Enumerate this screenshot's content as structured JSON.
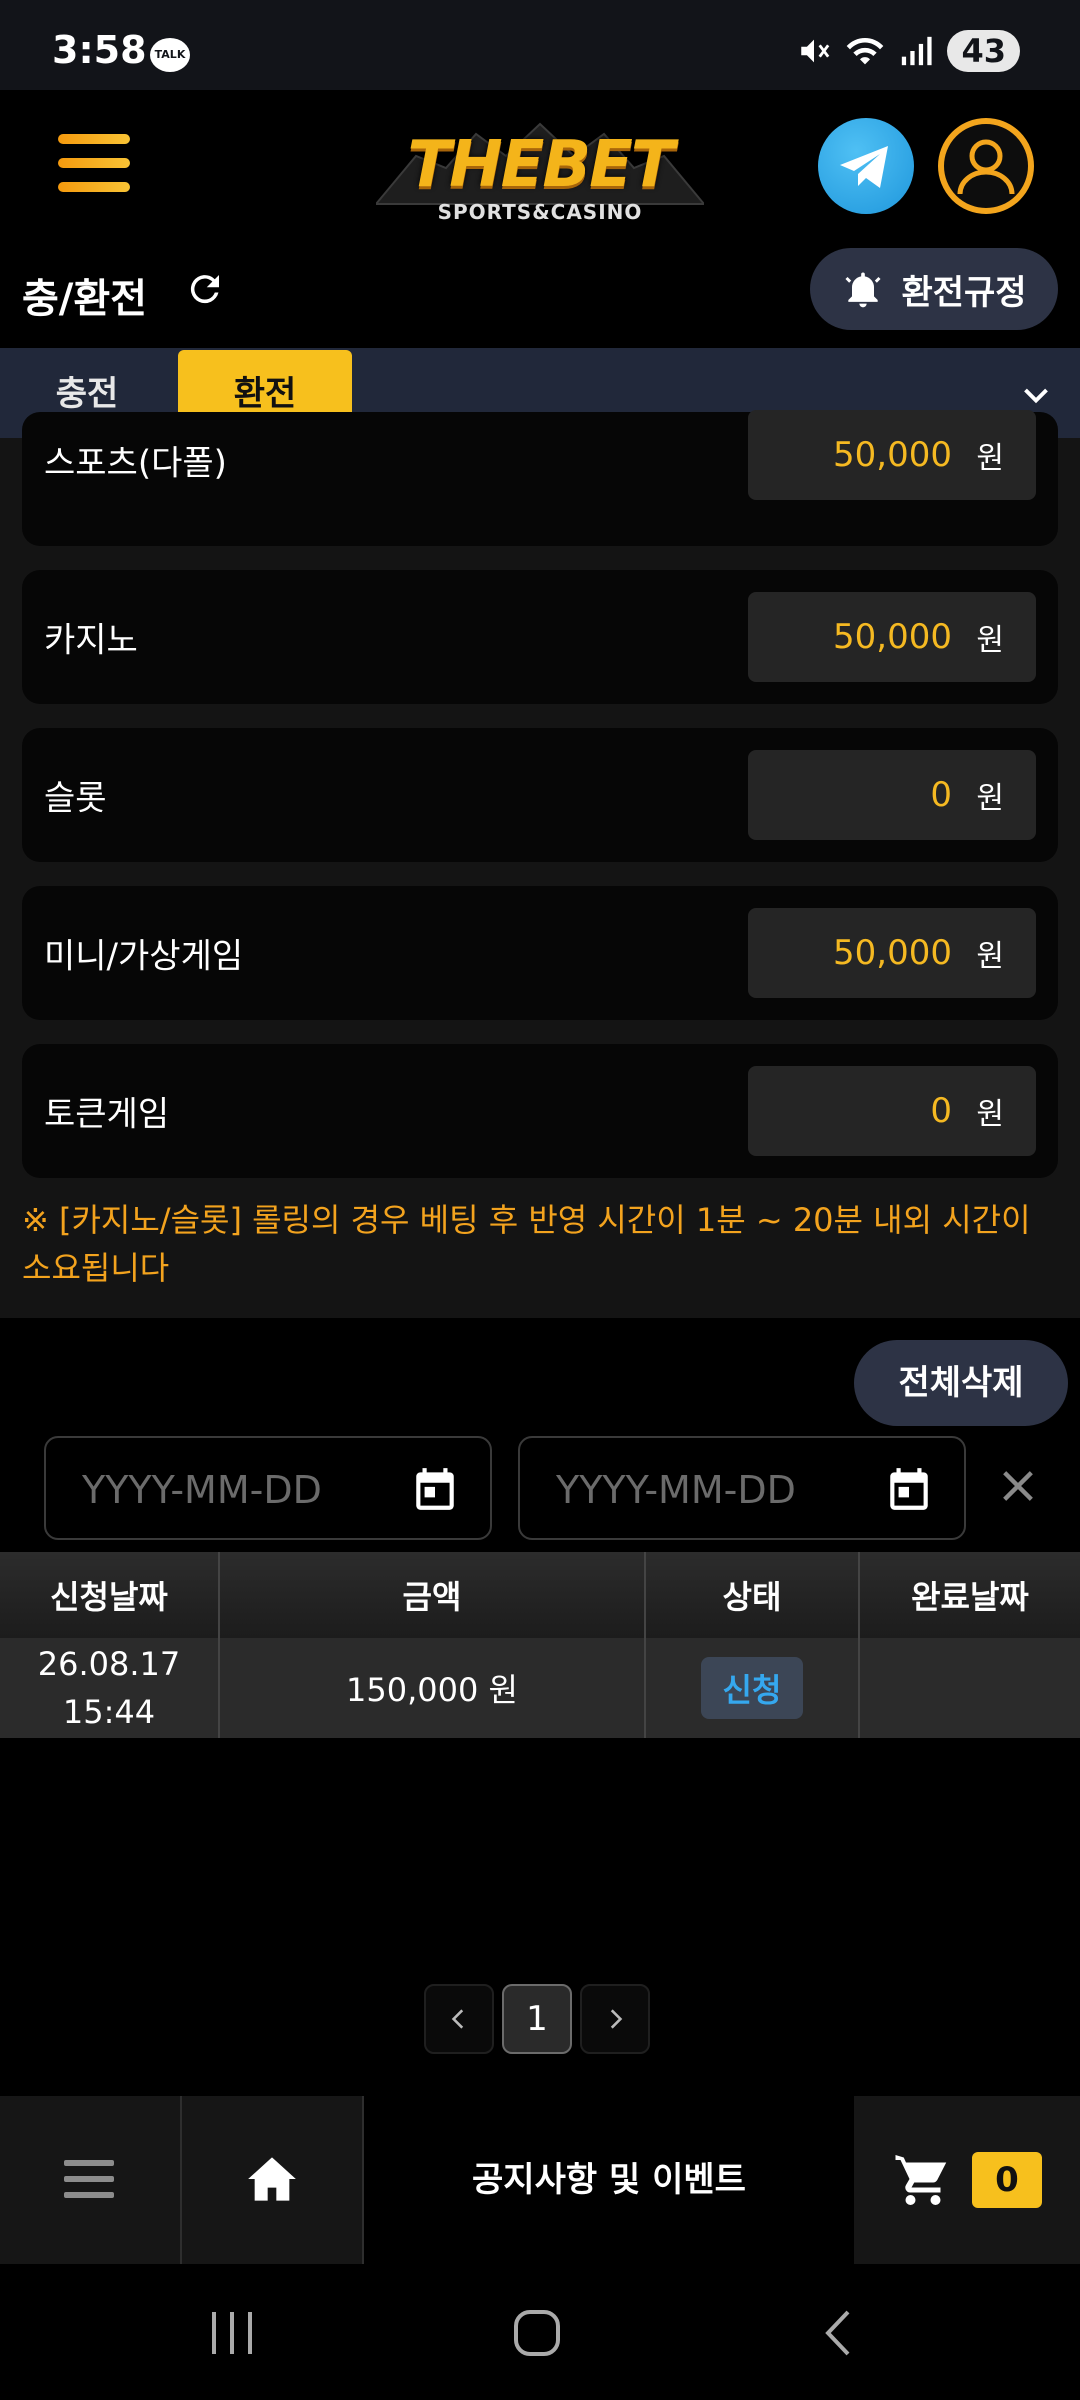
{
  "status_bar": {
    "time": "3:58",
    "talk_badge": "TALK",
    "battery": "43"
  },
  "header": {
    "logo_main": "THEBET",
    "logo_sub": "SPORTS&CASINO"
  },
  "page": {
    "title": "충/환전",
    "rules_button": "환전규정"
  },
  "tabs": [
    {
      "label": "충전"
    },
    {
      "label": "환전"
    }
  ],
  "rows": [
    {
      "label": "스포츠(다폴)",
      "value": "50,000",
      "unit": "원"
    },
    {
      "label": "카지노",
      "value": "50,000",
      "unit": "원"
    },
    {
      "label": "슬롯",
      "value": "0",
      "unit": "원"
    },
    {
      "label": "미니/가상게임",
      "value": "50,000",
      "unit": "원"
    },
    {
      "label": "토큰게임",
      "value": "0",
      "unit": "원"
    }
  ],
  "notice": "※ [카지노/슬롯] 롤링의 경우 베팅 후 반영 시간이 1분 ~ 20분 내외 시간이 소요됩니다",
  "history": {
    "delete_all": "전체삭제",
    "date_placeholder": "YYYY-MM-DD",
    "columns": [
      "신청날짜",
      "금액",
      "상태",
      "완료날짜"
    ],
    "rows": [
      {
        "date_line1": "26.08.17",
        "date_line2": "15:44",
        "amount": "150,000 원",
        "status": "신청",
        "completed": ""
      }
    ]
  },
  "pagination": {
    "current": "1"
  },
  "bottom_nav": {
    "notice_label": "공지사항 및 이벤트",
    "cart_count": "0"
  },
  "colors": {
    "accent": "#f7c01d",
    "value": "#f5b922",
    "notice": "#f3a31e",
    "status_link": "#35a8ef"
  }
}
